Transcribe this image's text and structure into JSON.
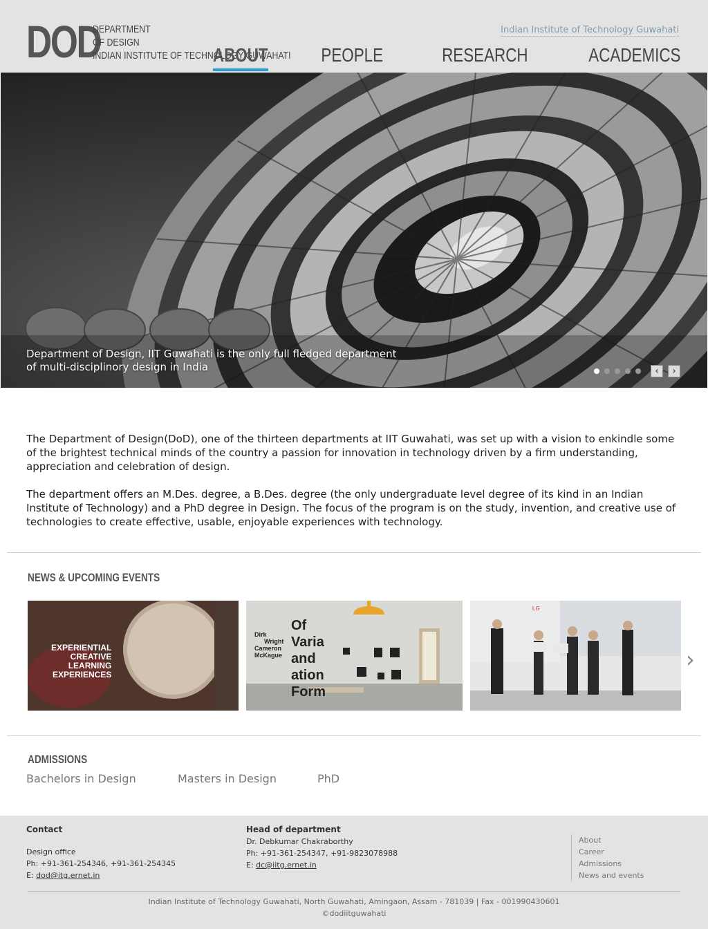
{
  "header": {
    "logo": "DOD",
    "logo_lines": [
      "DEPARTMENT",
      "OF DESIGN",
      "INDIAN INSTITUTE OF TECHNOLOGY GUWAHATI"
    ],
    "institute_link": "Indian Institute of Technology Guwahati",
    "nav": [
      {
        "label": "ABOUT",
        "active": true
      },
      {
        "label": "PEOPLE",
        "active": false
      },
      {
        "label": "RESEARCH",
        "active": false
      },
      {
        "label": "ACADEMICS",
        "active": false
      }
    ],
    "accent_color": "#2b9ad6"
  },
  "hero": {
    "caption_line1": "Department of Design, IIT Guwahati is the only full fledged department",
    "caption_line2": "of multi-disciplinory design in India",
    "slide_count": 5,
    "active_slide": 1
  },
  "intro": {
    "p1": "The Department of Design(DoD), one of the thirteen departments at IIT Guwahati, was set up with a vision to enkindle some of the brightest technical minds of the country a passion for innovation in technology driven by a firm understanding, appreciation and celebration of design.",
    "p2": "The department offers an M.Des. degree, a B.Des. degree (the only undergraduate level degree of its kind in an Indian Institute of Technology) and a PhD degree in Design. The focus of the program is on the study, invention, and creative use of technologies to create effective, usable, enjoyable experiences with technology."
  },
  "news": {
    "title": "NEWS & UPCOMING EVENTS",
    "card1_text": [
      "EXPERIENTIAL",
      "CREATIVE",
      "LEARNING",
      "EXPERIENCES"
    ],
    "card2_poster": [
      "Dirk",
      "Wright",
      "Cameron",
      "McKague",
      "Of",
      "Varia",
      "and",
      "ation",
      "Form"
    ]
  },
  "admissions": {
    "title": "ADMISSIONS",
    "links": [
      "Bachelors in Design",
      "Masters in Design",
      "PhD"
    ]
  },
  "footer": {
    "contact_title": "Contact",
    "design_office": "Design office",
    "office_phone": "Ph: +91-361-254346, +91-361-254345",
    "office_email_prefix": "E: ",
    "office_email": "dod@itg.ernet.in",
    "hod_title": "Head of department",
    "hod_name": "Dr. Debkumar Chakraborthy",
    "hod_phone": "Ph: +91-361-254347, +91-9823078988",
    "hod_email_prefix": "E: ",
    "hod_email": "dc@iitg.ernet.in",
    "links": [
      "About",
      "Career",
      "Admissions",
      "News and events"
    ],
    "address": "Indian Institute of Technology Guwahati, North Guwahati, Amingaon, Assam - 781039 | Fax - 001990430601",
    "copyright": "©dodiitguwahati"
  }
}
